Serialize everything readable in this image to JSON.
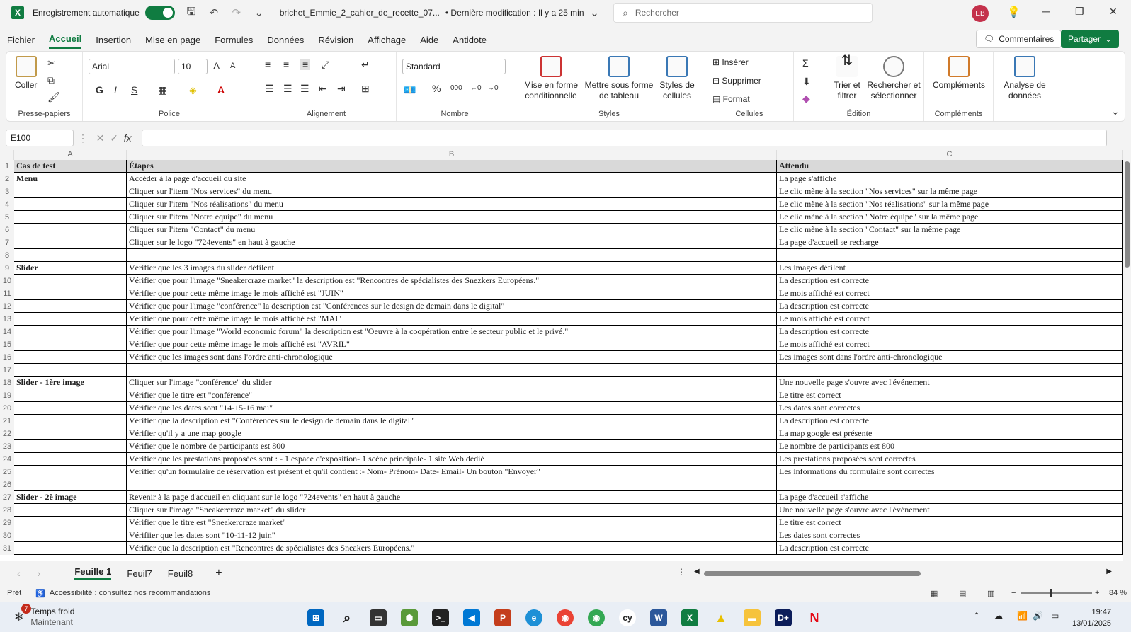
{
  "titlebar": {
    "autosave_label": "Enregistrement automatique",
    "filename": "brichet_Emmie_2_cahier_de_recette_07...",
    "modified": "• Dernière modification : Il y a 25 min",
    "search_placeholder": "Rechercher",
    "avatar": "EB",
    "icons": [
      "save-icon",
      "undo-icon",
      "redo-icon",
      "customize-icon"
    ]
  },
  "menu": {
    "items": [
      "Fichier",
      "Accueil",
      "Insertion",
      "Mise en page",
      "Formules",
      "Données",
      "Révision",
      "Affichage",
      "Aide",
      "Antidote"
    ],
    "comments": "Commentaires",
    "share": "Partager"
  },
  "ribbon": {
    "presse_papiers": {
      "coller": "Coller",
      "label": "Presse-papiers"
    },
    "police": {
      "font": "Arial",
      "size": "10",
      "bold": "G",
      "italic": "I",
      "underline": "S",
      "label": "Police"
    },
    "alignement": {
      "label": "Alignement"
    },
    "nombre": {
      "format": "Standard",
      "percent": "%",
      "thousands": "000",
      "label": "Nombre"
    },
    "styles": {
      "cond": "Mise en forme",
      "cond2": "conditionnelle",
      "table": "Mettre sous forme",
      "table2": "de tableau",
      "cell": "Styles de",
      "cell2": "cellules",
      "label": "Styles"
    },
    "cellules": {
      "insert": "Insérer",
      "delete": "Supprimer",
      "format": "Format",
      "label": "Cellules"
    },
    "edition": {
      "sort": "Trier et",
      "sort2": "filtrer",
      "find": "Rechercher et",
      "find2": "sélectionner",
      "label": "Édition"
    },
    "complements": {
      "add": "Compléments",
      "label": "Compléments"
    },
    "analyse": {
      "a1": "Analyse de",
      "a2": "données"
    }
  },
  "formula_bar": {
    "namebox": "E100",
    "fx": "fx",
    "value": ""
  },
  "columns": [
    "A",
    "B",
    "C"
  ],
  "rows": [
    [
      "Cas de test",
      "Étapes",
      "Attendu"
    ],
    [
      "Menu",
      "Accéder à la page d'accueil du site",
      "La page s'affiche"
    ],
    [
      "",
      "Cliquer sur l'item \"Nos services\" du menu",
      "Le clic mène à la section \"Nos services\" sur la même page"
    ],
    [
      "",
      "Cliquer sur l'item \"Nos réalisations\" du menu",
      "Le clic mène à la section \"Nos réalisations\" sur la même page"
    ],
    [
      "",
      "Cliquer sur l'item \"Notre équipe\" du menu",
      "Le clic mène à la section \"Notre équipe\" sur la même page"
    ],
    [
      "",
      "Cliquer sur l'item \"Contact\" du menu",
      "Le clic mène à la section \"Contact\" sur la même page"
    ],
    [
      "",
      "Cliquer sur le logo \"724events\" en haut à gauche",
      "La page d'accueil se recharge"
    ],
    [
      "",
      "",
      ""
    ],
    [
      "Slider",
      "Vérifier que les 3 images du slider défilent",
      "Les images défilent"
    ],
    [
      "",
      "Vérifier que pour l'image \"Sneakercraze market\" la description est \"Rencontres de spécialistes des Snezkers Européens.\"",
      "La description est correcte"
    ],
    [
      "",
      "Vérifier que pour cette même image le mois affiché est \"JUIN\"",
      "Le mois affiché est correct"
    ],
    [
      "",
      "Vérifier que pour l'image \"conférence\" la description est \"Conférences sur le design de demain dans le digital\"",
      "La description est correcte"
    ],
    [
      "",
      "Vérifier que pour cette même image le mois affiché est \"MAI\"",
      "Le mois affiché est correct"
    ],
    [
      "",
      "Vérifier que pour l'image \"World economic forum\" la description est \"Oeuvre à la coopération entre le secteur public et le privé.\"",
      "La description est correcte"
    ],
    [
      "",
      "Vérifier que pour cette même image le mois affiché est \"AVRIL\"",
      "Le mois affiché est correct"
    ],
    [
      "",
      "Vérifier que les images sont dans l'ordre anti-chronologique",
      "Les images sont dans l'ordre anti-chronologique"
    ],
    [
      "",
      "",
      ""
    ],
    [
      "Slider - 1ère image",
      "Cliquer sur l'image \"conférence\" du slider",
      "Une nouvelle page s'ouvre avec l'événement"
    ],
    [
      "",
      "Vérifier que le titre est \"conférence\"",
      "Le titre est correct"
    ],
    [
      "",
      "Vérifier que les dates sont \"14-15-16 mai\"",
      "Les dates sont correctes"
    ],
    [
      "",
      "Vérifier que la description est \"Conférences sur le design de demain dans le digital\"",
      "La description est correcte"
    ],
    [
      "",
      "Vérifier qu'il y a une map google",
      "La map google est présente"
    ],
    [
      "",
      "Vérifier que le nombre de participants est 800",
      "Le nombre de participants est 800"
    ],
    [
      "",
      "Vérifier que les prestations proposées sont : - 1 espace d'exposition- 1 scène principale- 1 site Web dédié",
      "Les prestations proposées sont correctes"
    ],
    [
      "",
      "Vérifier qu'un formulaire de réservation est présent et qu'il contient :- Nom- Prénom- Date- Email- Un bouton \"Envoyer\"",
      "Les informations du formulaire sont correctes"
    ],
    [
      "",
      "",
      ""
    ],
    [
      "Slider - 2è image",
      "Revenir à la page d'accueil en cliquant sur le logo \"724events\" en haut à gauche",
      "La page d'accueil s'affiche"
    ],
    [
      "",
      "Cliquer sur l'image \"Sneakercraze market\" du slider",
      "Une nouvelle page s'ouvre avec l'événement"
    ],
    [
      "",
      "Vérifier que le titre est \"Sneakercraze market\"",
      "Le titre est correct"
    ],
    [
      "",
      "Vérifiier que les dates sont \"10-11-12 juin\"",
      "Les dates sont correctes"
    ],
    [
      "",
      "Vérifier que la description est \"Rencontres de spécialistes des Sneakers Européens.\"",
      "La description est correcte"
    ]
  ],
  "sheets": [
    "Feuille 1",
    "Feuil7",
    "Feuil8"
  ],
  "status": {
    "ready": "Prêt",
    "accessibility": "Accessibilité : consultez nos recommandations",
    "zoom": "84 %"
  },
  "taskbar": {
    "weather_title": "Temps froid",
    "weather_sub": "Maintenant",
    "badge": "7",
    "time": "19:47",
    "date": "13/01/2025"
  }
}
